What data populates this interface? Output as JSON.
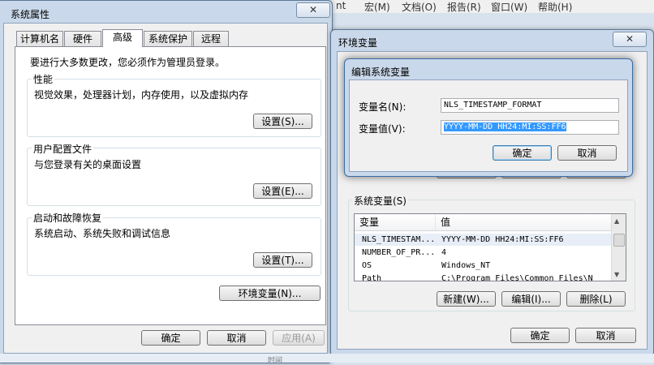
{
  "background": {
    "menu": [
      "nt",
      "宏(M)",
      "文档(O)",
      "报告(R)",
      "窗口(W)",
      "帮助(H)"
    ]
  },
  "system_properties": {
    "title": "系统属性",
    "tabs": [
      "计算机名",
      "硬件",
      "高级",
      "系统保护",
      "远程"
    ],
    "selected_tab": "高级",
    "admin_note": "要进行大多数更改，您必须作为管理员登录。",
    "performance": {
      "label": "性能",
      "desc": "视觉效果，处理器计划，内存使用，以及虚拟内存",
      "button": "设置(S)..."
    },
    "user_profiles": {
      "label": "用户配置文件",
      "desc": "与您登录有关的桌面设置",
      "button": "设置(E)..."
    },
    "startup_recovery": {
      "label": "启动和故障恢复",
      "desc": "系统启动、系统失败和调试信息",
      "button": "设置(T)..."
    },
    "env_button": "环境变量(N)...",
    "ok": "确定",
    "cancel": "取消",
    "apply": "应用(A)"
  },
  "env_vars": {
    "title": "环境变量",
    "system_vars_label": "系统变量(S)",
    "columns": [
      "变量",
      "值"
    ],
    "rows": [
      {
        "name": "NLS_TIMESTAM...",
        "value": "YYYY-MM-DD HH24:MI:SS:FF6"
      },
      {
        "name": "NUMBER_OF_PR...",
        "value": "4"
      },
      {
        "name": "OS",
        "value": "Windows_NT"
      },
      {
        "name": "Path",
        "value": "C:\\Program Files\\Common Files\\N"
      }
    ],
    "new_button": "新建(W)...",
    "edit_button": "编辑(I)...",
    "delete_button": "删除(L)",
    "ok": "确定",
    "cancel": "取消"
  },
  "edit_dialog": {
    "title": "编辑系统变量",
    "name_label": "变量名(N):",
    "name_value": "NLS_TIMESTAMP_FORMAT",
    "value_label": "变量值(V):",
    "value_value": "YYYY-MM-DD HH24:MI:SS:FF6",
    "ok": "确定",
    "cancel": "取消"
  },
  "bottom_strip": {
    "left_text": "时间"
  },
  "colors": {
    "selection": "#3399ff",
    "frame": "#c9d8ea",
    "client": "#f0f0f0"
  }
}
